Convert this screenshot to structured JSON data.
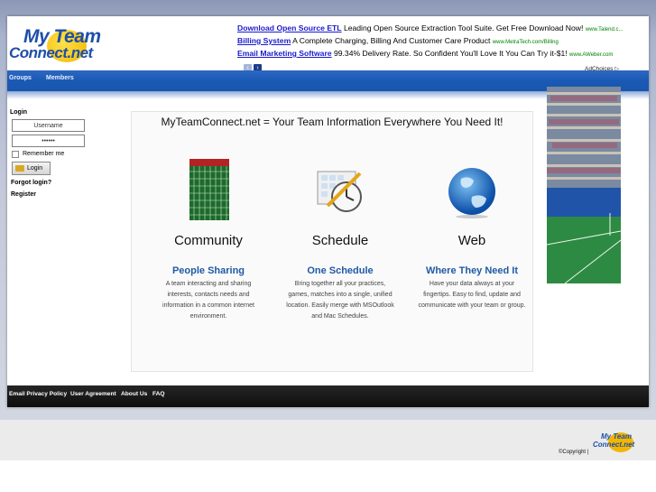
{
  "header": {
    "logo_line1": "My Team",
    "logo_line2": "Connect.net",
    "ads": [
      {
        "title": "Download Open Source ETL",
        "desc": "Leading Open Source Extraction Tool Suite. Get Free Download Now!",
        "url": "www.Talend.c..."
      },
      {
        "title": "Billing System",
        "desc": "A Complete Charging, Billing And Customer Care Product",
        "url": "www.MetraTech.com/Billing"
      },
      {
        "title": "Email Marketing Software",
        "desc": "99.34% Delivery Rate. So Confident You'll Love It You Can Try it-$1!",
        "url": "www.AWeber.com"
      }
    ],
    "adchoices": "AdChoices ▷",
    "ad_prev": "‹",
    "ad_next": "›"
  },
  "nav": {
    "groups": "Groups",
    "members": "Members"
  },
  "login": {
    "title": "Login",
    "username_value": "Username",
    "password_value": "••••••",
    "remember": "Remember me",
    "button": "Login",
    "forgot": "Forgot login?",
    "register": "Register"
  },
  "main": {
    "headline": "MyTeamConnect.net = Your Team Information Everywhere You Need It!",
    "features": [
      {
        "name": "Community",
        "sub": "People Sharing",
        "desc": "A team interacting and sharing interests, contacts needs and information in a common internet environment."
      },
      {
        "name": "Schedule",
        "sub": "One Schedule",
        "desc": "Bring together all your practices, games, matches into a single, unified location.  Easily merge with MSOutlook and Mac Schedules."
      },
      {
        "name": "Web",
        "sub": "Where They Need It",
        "desc": "Have your data always at your fingertips.  Easy to find, update and communicate with your team or group."
      }
    ]
  },
  "footer": {
    "links": [
      "Email Privacy Policy",
      "User Agreement",
      "About Us",
      "FAQ"
    ],
    "copyright": "©Copyright |"
  },
  "colors": {
    "nav_blue": "#195ab5",
    "link_blue": "#1a1acc",
    "feature_blue": "#1f5aa6",
    "logo_yellow": "#f2b600"
  }
}
